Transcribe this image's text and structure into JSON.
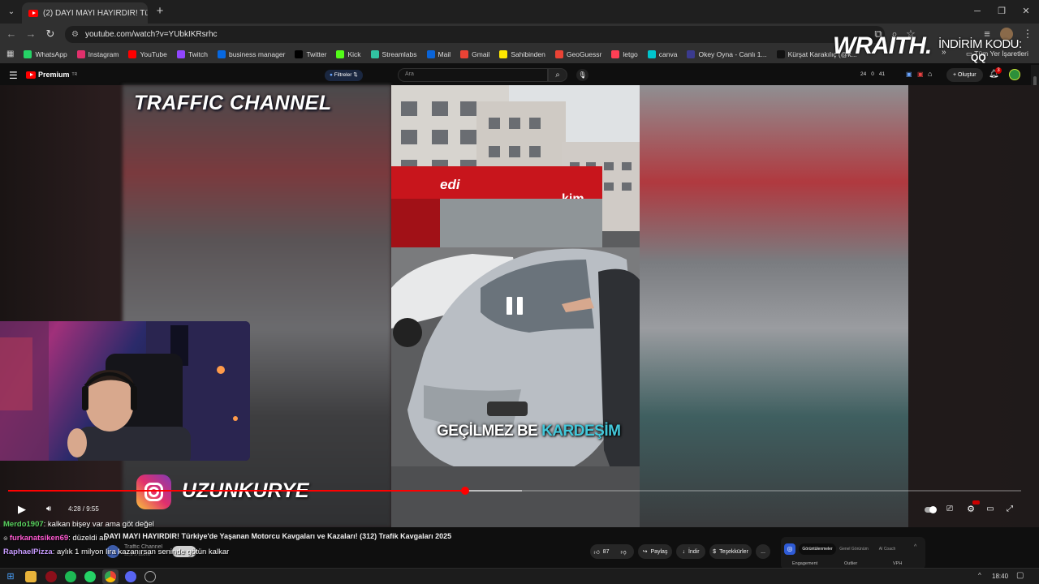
{
  "browser": {
    "tab_title": "(2) DAYI MAYI HAYIRDIR! Tü",
    "new_tab_label": "+",
    "url": "youtube.com/watch?v=YUbkIKRsrhc",
    "bookmarks": [
      {
        "label": "WhatsApp",
        "icon": "whatsapp-icon",
        "color": "#25d366"
      },
      {
        "label": "Instagram",
        "icon": "instagram-icon",
        "color": "#e1306c"
      },
      {
        "label": "YouTube",
        "icon": "youtube-icon",
        "color": "#ff0000"
      },
      {
        "label": "Twitch",
        "icon": "twitch-icon",
        "color": "#9146ff"
      },
      {
        "label": "business manager",
        "icon": "meta-icon",
        "color": "#0668e1"
      },
      {
        "label": "Twitter",
        "icon": "x-icon",
        "color": "#000000"
      },
      {
        "label": "Kick",
        "icon": "kick-icon",
        "color": "#53fc18"
      },
      {
        "label": "Streamlabs",
        "icon": "streamlabs-icon",
        "color": "#31c3a2"
      },
      {
        "label": "Mail",
        "icon": "mail-icon",
        "color": "#0a64d8"
      },
      {
        "label": "Gmail",
        "icon": "gmail-icon",
        "color": "#ea4335"
      },
      {
        "label": "Sahibinden",
        "icon": "sahibinden-icon",
        "color": "#ffe800"
      },
      {
        "label": "GeoGuessr",
        "icon": "map-pin-icon",
        "color": "#ea4335"
      },
      {
        "label": "letgo",
        "icon": "letgo-icon",
        "color": "#ff3f55"
      },
      {
        "label": "canva",
        "icon": "canva-icon",
        "color": "#00c4cc"
      },
      {
        "label": "Okey Oyna - Canlı 1...",
        "icon": "okey-icon",
        "color": "#3b3b8f"
      },
      {
        "label": "Kürşat Karakılıç (@k...",
        "icon": "tiktok-icon",
        "color": "#111111"
      }
    ],
    "bookmarks_more": "»",
    "bookmarks_folder": "Tüm Yer İşaretleri"
  },
  "youtube": {
    "logo_label": "Premium",
    "logo_sup": "TR",
    "filter_label": "Filtreler",
    "search_placeholder": "Ara",
    "stats": [
      "24",
      "0",
      "41"
    ],
    "create_label": "Oluştur",
    "notif_count": "3"
  },
  "video": {
    "watermark_top": "TRAFFIC CHANNEL",
    "watermark_bottom": "UZUNKURYE",
    "subtitle_main": "GEÇİLMEZ BE ",
    "subtitle_highlight": "KARDEŞİM",
    "time": "4:28 / 9:55",
    "progress": 0.451,
    "title": "DAYI MAYI HAYIRDIR! Türkiye'de Yaşanan Motorcu Kavgaları ve Kazaları! (312) Trafik Kavgaları 2025",
    "channel": "Traffic Channel",
    "subs": "92,8 B abone",
    "likes": "87",
    "share": "Paylaş",
    "download": "İndir",
    "thanks": "Teşekkürler",
    "more": "..."
  },
  "studio_panel": {
    "tabs": [
      "Görüntülenmeler",
      "Genel Görünüm",
      "AI Coach"
    ],
    "cols": [
      "Engagement",
      "Outlier",
      "VPH"
    ]
  },
  "chat": [
    {
      "user": "Merdo1907",
      "user_color": "#58d35f",
      "msg": ": kalkan bişey var ama göt değel"
    },
    {
      "user": "furkanatsiken69",
      "user_color": "#ff5ad2",
      "msg": ": düzeldi ab"
    },
    {
      "user": "RaphaelPizza",
      "user_color": "#c79bff",
      "msg": ": aylık 1 milyon lira kazanırsan seninde götün kalkar"
    }
  ],
  "sponsor": {
    "brand": "WRAITH.",
    "promo_label": "İNDİRİM KODU:",
    "promo_code": "QQ"
  },
  "taskbar": {
    "time": "18:40",
    "caret": "^"
  }
}
